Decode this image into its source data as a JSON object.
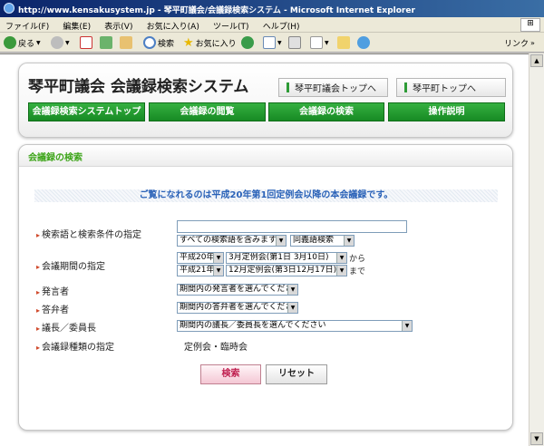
{
  "window": {
    "title": "http://www.kensakusystem.jp - 琴平町議会/会議録検索システム - Microsoft Internet Explorer"
  },
  "menu": {
    "items": [
      "ファイル(F)",
      "編集(E)",
      "表示(V)",
      "お気に入り(A)",
      "ツール(T)",
      "ヘルプ(H)"
    ]
  },
  "toolbar": {
    "back": "戻る",
    "search": "検索",
    "favorites": "お気に入り",
    "links": "リンク"
  },
  "header": {
    "title": "琴平町議会  会議録検索システム",
    "links": [
      "琴平町議会トップへ",
      "琴平町トップへ"
    ]
  },
  "nav": {
    "buttons": [
      "会議録検索システムトップ",
      "会議録の閲覧",
      "会議録の検索",
      "操作説明"
    ]
  },
  "section": {
    "title": "会議録の検索",
    "notice": "ご覧になれるのは平成20年第1回定例会以降の本会議録です。"
  },
  "form": {
    "keyword": {
      "label": "検索語と検索条件の指定",
      "value": "",
      "condition": "すべての検索語を含みます",
      "synonym": "同義語検索"
    },
    "period": {
      "label": "会議期間の指定",
      "from_year": "平成20年",
      "from_session": "3月定例会(第1日 3月10日)",
      "from_suffix": "から",
      "to_year": "平成21年",
      "to_session": "12月定例会(第3日12月17日)",
      "to_suffix": "まで"
    },
    "speaker": {
      "label": "発言者",
      "value": "期間内の発言者を選んでください"
    },
    "answerer": {
      "label": "答弁者",
      "value": "期間内の答弁者を選んでください"
    },
    "chair": {
      "label": "議長／委員長",
      "value": "期間内の議長／委員長を選んでください"
    },
    "type": {
      "label": "会議録種類の指定",
      "value": "定例会・臨時会"
    }
  },
  "actions": {
    "search": "検索",
    "reset": "リセット"
  },
  "colors": {
    "accent_green": "#2d9b36",
    "notice_blue": "#2a62b8",
    "search_pink": "#c02050"
  }
}
